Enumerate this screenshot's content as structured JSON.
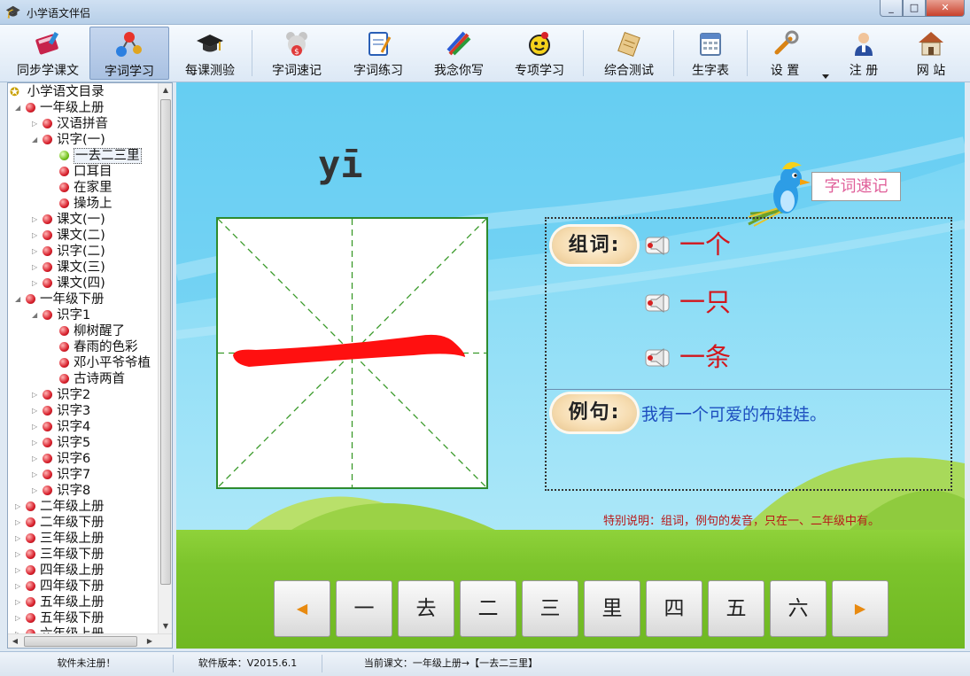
{
  "window": {
    "title": "小学语文伴侣",
    "minimize": "_",
    "maximize": "□",
    "close": "✕"
  },
  "toolbar": {
    "items": [
      {
        "label": "同步学课文",
        "icon": "book-icon"
      },
      {
        "label": "字词学习",
        "icon": "molecule-icon"
      },
      {
        "label": "每课测验",
        "icon": "graduation-cap-icon"
      },
      {
        "label": "字词速记",
        "icon": "mouse-icon"
      },
      {
        "label": "字词练习",
        "icon": "worksheet-icon"
      },
      {
        "label": "我念你写",
        "icon": "pencils-icon"
      },
      {
        "label": "专项学习",
        "icon": "ladybug-icon"
      },
      {
        "label": "综合测试",
        "icon": "scroll-icon"
      },
      {
        "label": "生字表",
        "icon": "calendar-icon"
      },
      {
        "label": "设 置",
        "icon": "wrench-icon"
      },
      {
        "label": "注  册",
        "icon": "user-icon"
      },
      {
        "label": "网  站",
        "icon": "home-icon"
      }
    ],
    "active_index": 1
  },
  "tree": {
    "root": "小学语文目录",
    "nodes": [
      {
        "label": "一年级上册"
      },
      {
        "label": "汉语拼音"
      },
      {
        "label": "识字(一)"
      },
      {
        "label": "一去二三里"
      },
      {
        "label": "口耳目"
      },
      {
        "label": "在家里"
      },
      {
        "label": "操场上"
      },
      {
        "label": "课文(一)"
      },
      {
        "label": "课文(二)"
      },
      {
        "label": "识字(二)"
      },
      {
        "label": "课文(三)"
      },
      {
        "label": "课文(四)"
      },
      {
        "label": "一年级下册"
      },
      {
        "label": "识字1"
      },
      {
        "label": "柳树醒了"
      },
      {
        "label": "春雨的色彩"
      },
      {
        "label": "邓小平爷爷植"
      },
      {
        "label": "古诗两首"
      },
      {
        "label": "识字2"
      },
      {
        "label": "识字3"
      },
      {
        "label": "识字4"
      },
      {
        "label": "识字5"
      },
      {
        "label": "识字6"
      },
      {
        "label": "识字7"
      },
      {
        "label": "识字8"
      },
      {
        "label": "二年级上册"
      },
      {
        "label": "二年级下册"
      },
      {
        "label": "三年级上册"
      },
      {
        "label": "三年级下册"
      },
      {
        "label": "四年级上册"
      },
      {
        "label": "四年级下册"
      },
      {
        "label": "五年级上册"
      },
      {
        "label": "五年级下册"
      },
      {
        "label": "六年级上册"
      }
    ],
    "selected": "一去二三里"
  },
  "lesson": {
    "pinyin": "yī",
    "character": "一",
    "tag": "字词速记",
    "words_label": "组词:",
    "words": [
      "一个",
      "一只",
      "一条"
    ],
    "sentence_label": "例句:",
    "sentence": "我有一个可爱的布娃娃。",
    "note": "特别说明：组词，例句的发音，只在一、二年级中有。"
  },
  "nav": {
    "prev": "◀",
    "next": "▶",
    "chars": [
      "一",
      "去",
      "二",
      "三",
      "里",
      "四",
      "五",
      "六"
    ]
  },
  "status": {
    "registration": "软件未注册！",
    "version": "软件版本：V2015.6.1",
    "current": "当前课文：一年级上册→【一去二三里】"
  },
  "colors": {
    "sky": "#8bdcf6",
    "grass": "#7cc42c",
    "stroke_red": "#ff1010",
    "word_red": "#d2161c",
    "sentence_blue": "#1d4fbf"
  }
}
